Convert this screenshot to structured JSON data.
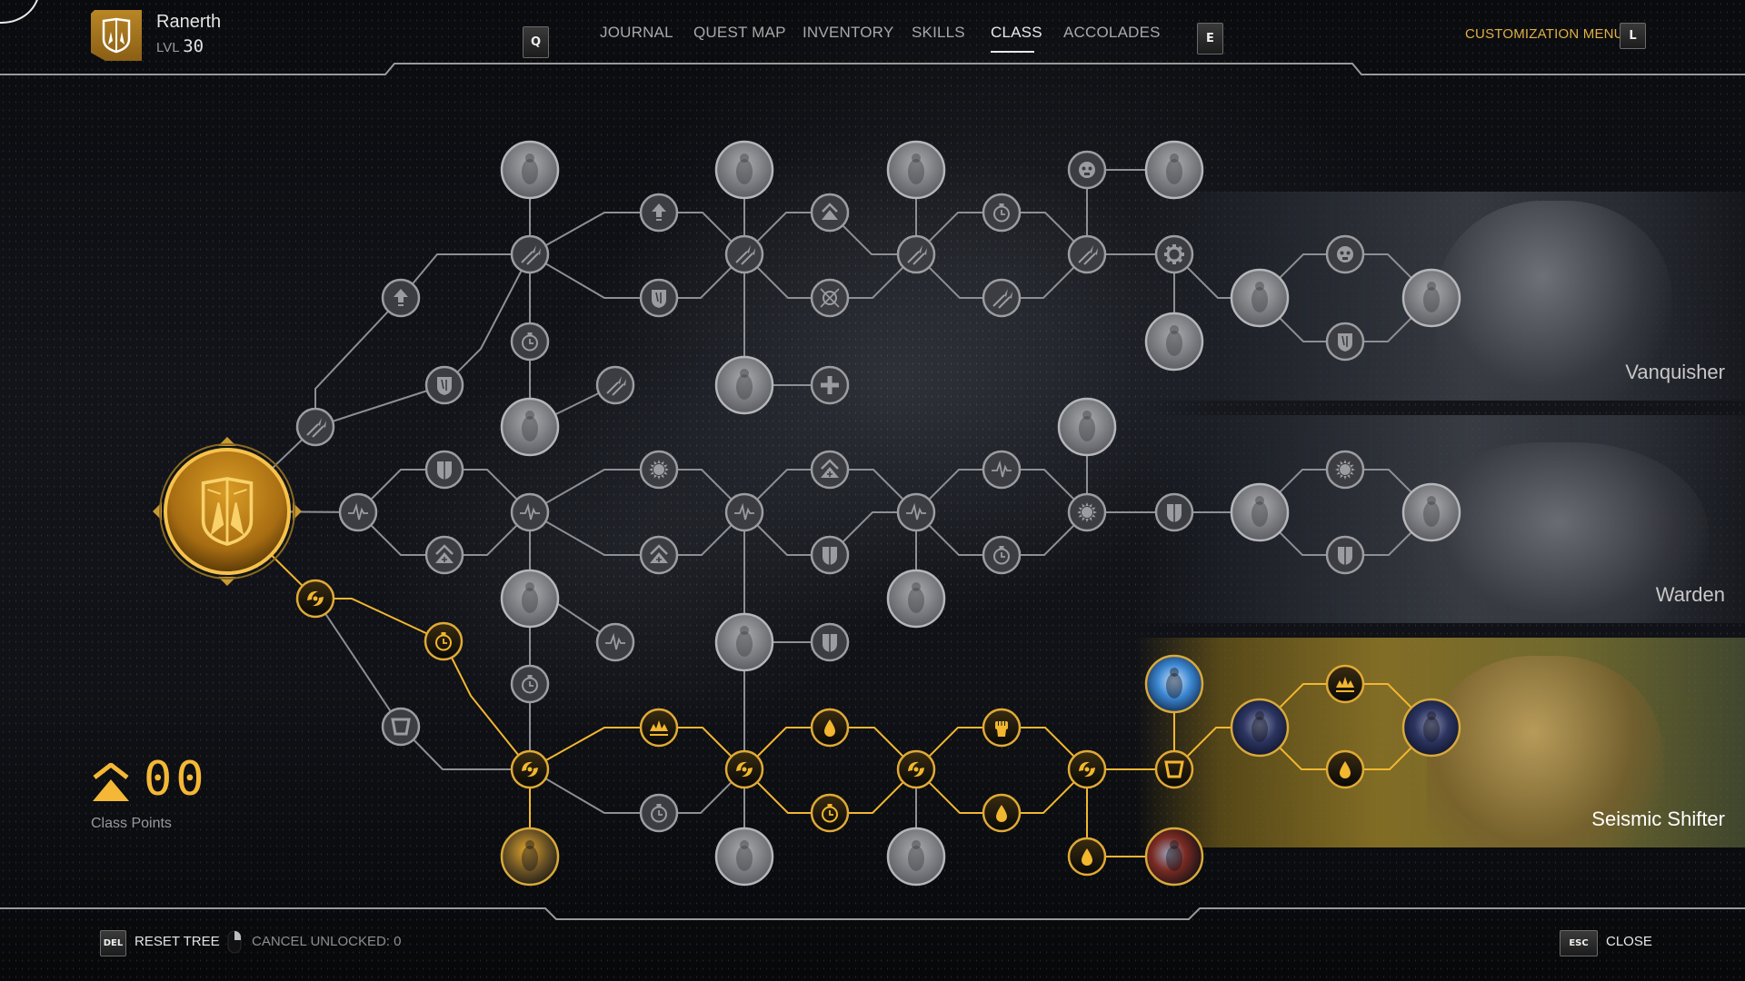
{
  "player": {
    "name": "Ranerth",
    "level_label": "LVL",
    "level": "30"
  },
  "nav": {
    "prev_key": "Q",
    "next_key": "E",
    "tabs": [
      {
        "label": "JOURNAL",
        "active": false
      },
      {
        "label": "QUEST MAP",
        "active": false
      },
      {
        "label": "INVENTORY",
        "active": false
      },
      {
        "label": "SKILLS",
        "active": false
      },
      {
        "label": "CLASS",
        "active": true
      },
      {
        "label": "ACCOLADES",
        "active": false
      }
    ],
    "customization_label": "CUSTOMIZATION MENU",
    "customization_key": "L"
  },
  "class_points": {
    "value": "00",
    "label": "Class Points"
  },
  "footer": {
    "reset_key": "DEL",
    "reset_label": "RESET TREE",
    "cancel_label": "CANCEL UNLOCKED: 0",
    "close_key": "ESC",
    "close_label": "CLOSE"
  },
  "subclasses": [
    {
      "name": "Vanquisher",
      "unlocked": false
    },
    {
      "name": "Warden",
      "unlocked": false
    },
    {
      "name": "Seismic Shifter",
      "unlocked": true
    }
  ],
  "colors": {
    "gold": "#f2b72f",
    "locked": "#8d8f94",
    "locked_fill": "#3b3d42",
    "active_fill": "#101010"
  },
  "tree": {
    "root": {
      "id": "root",
      "icon": "class-shield-icon",
      "unlocked": true
    },
    "nodes": [
      {
        "id": "a1",
        "icon": "spears-icon",
        "unlocked": false
      },
      {
        "id": "a2",
        "icon": "upgrade-arrow-icon",
        "unlocked": false
      },
      {
        "id": "a3",
        "icon": "claw-shield-icon",
        "unlocked": false
      },
      {
        "id": "h1",
        "icon": "spears-icon",
        "unlocked": false
      },
      {
        "id": "p1",
        "icon": "portrait-icon",
        "unlocked": false
      },
      {
        "id": "t1",
        "icon": "timer-icon",
        "unlocked": false
      },
      {
        "id": "p2",
        "icon": "portrait-icon",
        "unlocked": false
      },
      {
        "id": "s1",
        "icon": "spears-icon",
        "unlocked": false
      },
      {
        "id": "u1",
        "icon": "upgrade-arrow-icon",
        "unlocked": false
      },
      {
        "id": "c1",
        "icon": "claw-shield-icon",
        "unlocked": false
      },
      {
        "id": "h2",
        "icon": "spears-icon",
        "unlocked": false
      },
      {
        "id": "p3",
        "icon": "portrait-icon",
        "unlocked": false
      },
      {
        "id": "p4",
        "icon": "portrait-icon",
        "unlocked": false
      },
      {
        "id": "plus1",
        "icon": "plus-icon",
        "unlocked": false
      },
      {
        "id": "ch1",
        "icon": "chevron-up-icon",
        "unlocked": false
      },
      {
        "id": "x1",
        "icon": "crosshair-icon",
        "unlocked": false
      },
      {
        "id": "h3",
        "icon": "spears-icon",
        "unlocked": false
      },
      {
        "id": "p5",
        "icon": "portrait-icon",
        "unlocked": false
      },
      {
        "id": "t2",
        "icon": "timer-icon",
        "unlocked": false
      },
      {
        "id": "s2",
        "icon": "spears-icon",
        "unlocked": false
      },
      {
        "id": "h4",
        "icon": "spears-icon",
        "unlocked": false
      },
      {
        "id": "f1",
        "icon": "face-icon",
        "unlocked": false
      },
      {
        "id": "p6",
        "icon": "portrait-icon",
        "unlocked": false
      },
      {
        "id": "g1",
        "icon": "gear-icon",
        "unlocked": false
      },
      {
        "id": "p7",
        "icon": "portrait-icon",
        "unlocked": false
      },
      {
        "id": "v1",
        "icon": "portrait-icon",
        "unlocked": false
      },
      {
        "id": "v2",
        "icon": "face-icon",
        "unlocked": false
      },
      {
        "id": "v3",
        "icon": "claw-shield-icon",
        "unlocked": false
      },
      {
        "id": "v4",
        "icon": "portrait-icon",
        "unlocked": false
      },
      {
        "id": "b1",
        "icon": "pulse-icon",
        "unlocked": false
      },
      {
        "id": "b2",
        "icon": "shield-icon",
        "unlocked": false
      },
      {
        "id": "b3",
        "icon": "chevron-plus-icon",
        "unlocked": false
      },
      {
        "id": "bh1",
        "icon": "pulse-icon",
        "unlocked": false
      },
      {
        "id": "sun1",
        "icon": "sun-icon",
        "unlocked": false
      },
      {
        "id": "cp1",
        "icon": "chevron-plus-icon",
        "unlocked": false
      },
      {
        "id": "bh2",
        "icon": "pulse-icon",
        "unlocked": false
      },
      {
        "id": "cp2",
        "icon": "chevron-plus-icon",
        "unlocked": false
      },
      {
        "id": "sh1",
        "icon": "shield-icon",
        "unlocked": false
      },
      {
        "id": "bh3",
        "icon": "pulse-icon",
        "unlocked": false
      },
      {
        "id": "pu1",
        "icon": "pulse-icon",
        "unlocked": false
      },
      {
        "id": "t3",
        "icon": "timer-icon",
        "unlocked": false
      },
      {
        "id": "sun2",
        "icon": "sun-icon",
        "unlocked": false
      },
      {
        "id": "p8",
        "icon": "portrait-icon",
        "unlocked": false
      },
      {
        "id": "p9",
        "icon": "portrait-icon",
        "unlocked": false
      },
      {
        "id": "sh2",
        "icon": "shield-icon",
        "unlocked": false
      },
      {
        "id": "w1",
        "icon": "portrait-icon",
        "unlocked": false
      },
      {
        "id": "w2",
        "icon": "sun-icon",
        "unlocked": false
      },
      {
        "id": "w3",
        "icon": "shield-icon",
        "unlocked": false
      },
      {
        "id": "w4",
        "icon": "portrait-icon",
        "unlocked": false
      },
      {
        "id": "p10",
        "icon": "portrait-icon",
        "unlocked": false
      },
      {
        "id": "pu2",
        "icon": "pulse-icon",
        "unlocked": false
      },
      {
        "id": "t4",
        "icon": "timer-icon",
        "unlocked": false
      },
      {
        "id": "p11",
        "icon": "portrait-icon",
        "unlocked": false
      },
      {
        "id": "sh3",
        "icon": "shield-icon",
        "unlocked": false
      },
      {
        "id": "g_sw1",
        "icon": "swirl-icon",
        "unlocked": true
      },
      {
        "id": "g_t1",
        "icon": "timer-icon",
        "unlocked": true
      },
      {
        "id": "br1",
        "icon": "bracket-icon",
        "unlocked": false
      },
      {
        "id": "g_h1",
        "icon": "swirl-icon",
        "unlocked": true
      },
      {
        "id": "g_p1",
        "icon": "portrait-icon",
        "unlocked": true
      },
      {
        "id": "g_cr1",
        "icon": "crown-icon",
        "unlocked": true
      },
      {
        "id": "t5",
        "icon": "timer-icon",
        "unlocked": false
      },
      {
        "id": "g_h2",
        "icon": "swirl-icon",
        "unlocked": true
      },
      {
        "id": "p12",
        "icon": "portrait-icon",
        "unlocked": false
      },
      {
        "id": "g_d1",
        "icon": "drop-icon",
        "unlocked": true
      },
      {
        "id": "g_t2",
        "icon": "timer-icon",
        "unlocked": true
      },
      {
        "id": "g_h3",
        "icon": "swirl-icon",
        "unlocked": true
      },
      {
        "id": "p13",
        "icon": "portrait-icon",
        "unlocked": false
      },
      {
        "id": "g_fi1",
        "icon": "fist-icon",
        "unlocked": true
      },
      {
        "id": "g_d2",
        "icon": "drop-icon",
        "unlocked": true
      },
      {
        "id": "g_h4",
        "icon": "swirl-icon",
        "unlocked": true
      },
      {
        "id": "g_d3",
        "icon": "drop-icon",
        "unlocked": true
      },
      {
        "id": "g_p2",
        "icon": "portrait-icon",
        "unlocked": true
      },
      {
        "id": "g_br",
        "icon": "bracket-icon",
        "unlocked": true
      },
      {
        "id": "g_p3",
        "icon": "portrait-icon",
        "unlocked": true
      },
      {
        "id": "g_p4",
        "icon": "portrait-icon",
        "unlocked": true
      },
      {
        "id": "g_cr2",
        "icon": "crown-icon",
        "unlocked": true
      },
      {
        "id": "g_d4",
        "icon": "drop-icon",
        "unlocked": true
      },
      {
        "id": "g_p5",
        "icon": "portrait-icon",
        "unlocked": true
      }
    ]
  }
}
